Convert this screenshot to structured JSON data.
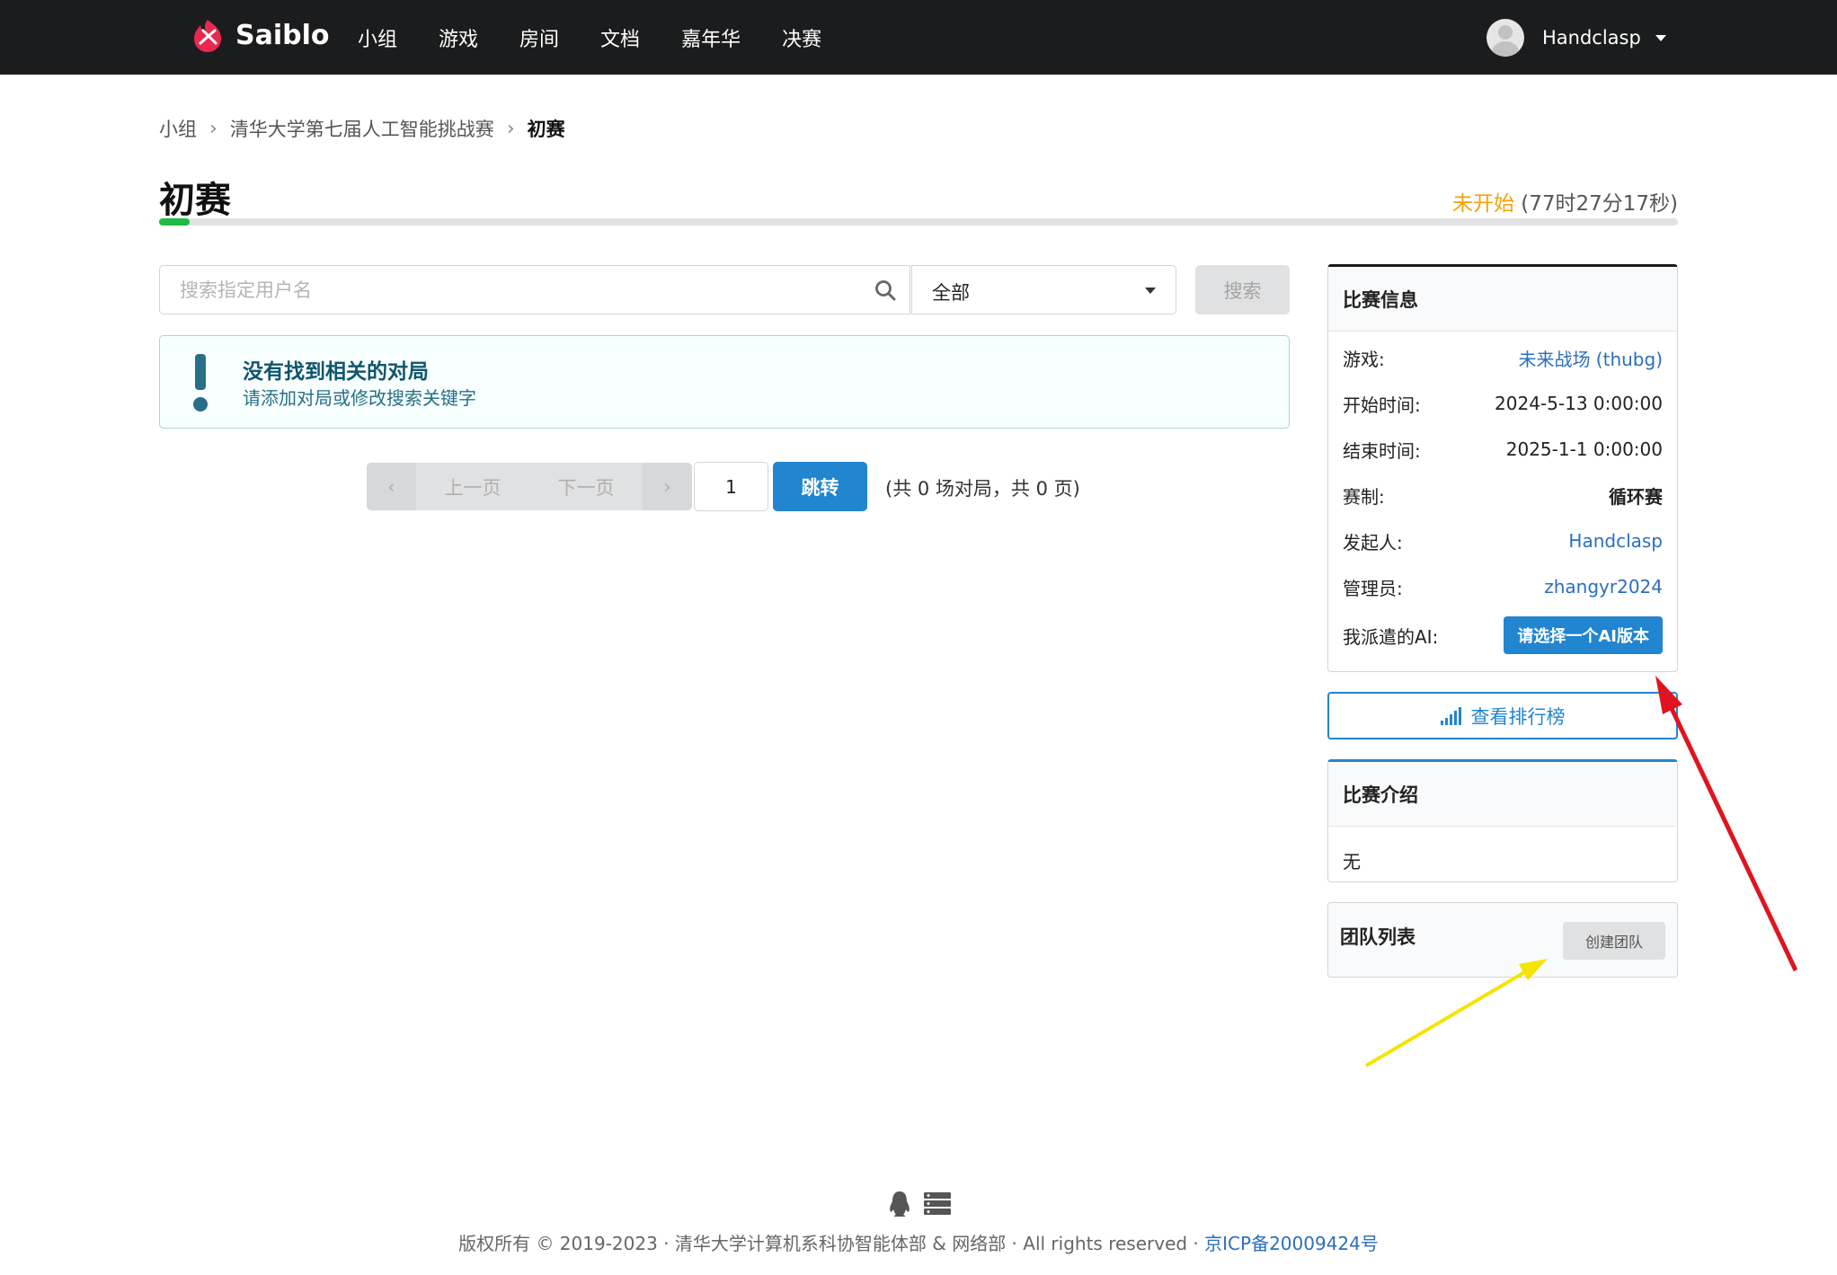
{
  "navbar": {
    "brand": "Saiblo",
    "items": [
      "小组",
      "游戏",
      "房间",
      "文档",
      "嘉年华",
      "决赛"
    ],
    "user": "Handclasp"
  },
  "breadcrumb": {
    "items": [
      "小组",
      "清华大学第七届人工智能挑战赛"
    ],
    "current": "初赛"
  },
  "page": {
    "title": "初赛",
    "status_label": "未开始",
    "status_countdown": "(77时27分17秒)",
    "status_color": "#f2a20b",
    "progress_fraction": 0.02
  },
  "search": {
    "placeholder": "搜索指定用户名",
    "filter_value": "全部",
    "button": "搜索"
  },
  "message": {
    "header": "没有找到相关的对局",
    "body": "请添加对局或修改搜索关键字"
  },
  "pagination": {
    "prev": "上一页",
    "next": "下一页",
    "page_input": "1",
    "jump": "跳转",
    "summary": "(共 0 场对局，共 0 页)"
  },
  "match_info": {
    "title": "比赛信息",
    "rows": [
      {
        "label": "游戏:",
        "value": "未来战场 (thubg)"
      },
      {
        "label": "开始时间:",
        "value": "2024-5-13 0:00:00"
      },
      {
        "label": "结束时间:",
        "value": "2025-1-1 0:00:00"
      },
      {
        "label": "赛制:",
        "value": "循环赛"
      },
      {
        "label": "发起人:",
        "value": "Handclasp"
      },
      {
        "label": "管理员:",
        "value": "zhangyr2024"
      },
      {
        "label": "我派遣的AI:",
        "value": "请选择一个AI版本"
      }
    ]
  },
  "ranking_button": "查看排行榜",
  "intro": {
    "title": "比赛介绍",
    "body": "无"
  },
  "teams": {
    "title": "团队列表",
    "create_button": "创建团队"
  },
  "footer": {
    "text": "版权所有 © 2019-2023 · 清华大学计算机系科协智能体部 & 网络部 · All rights reserved · ",
    "icp": "京ICP备20009424号"
  },
  "colors": {
    "primary": "#2185d0",
    "navbar": "#1b1c1d",
    "success": "#21ba45",
    "annotation_red": "#e0141e",
    "annotation_yellow": "#f5e400"
  }
}
